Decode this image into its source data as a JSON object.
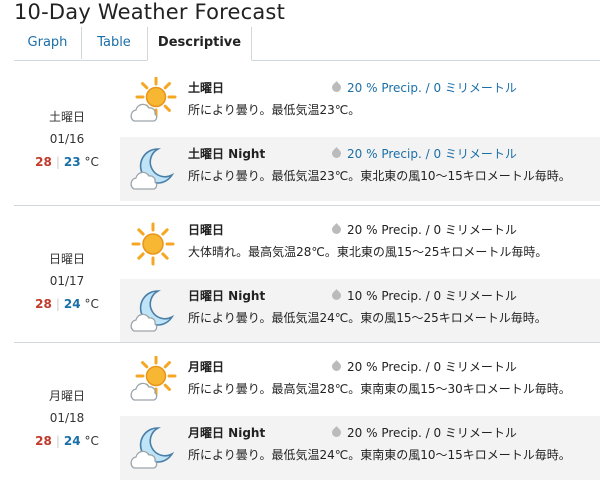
{
  "title": "10-Day Weather Forecast",
  "tabs": [
    "Graph",
    "Table",
    "Descriptive"
  ],
  "days": [
    {
      "name": "土曜日",
      "date": "01/16",
      "high": "28",
      "low": "23",
      "unit": "°C",
      "periods": [
        {
          "name": "土曜日",
          "icon": "sun-cloud-icon",
          "pct": "20",
          "pct_label": "% Precip. /",
          "amount": "0",
          "amount_unit": "ミリメートル",
          "highlight": true,
          "desc": "所により曇り。最低気温23℃。"
        },
        {
          "name": "土曜日 Night",
          "icon": "moon-cloud-icon",
          "pct": "20",
          "pct_label": "% Precip. /",
          "amount": "0",
          "amount_unit": "ミリメートル",
          "highlight": true,
          "desc": "所により曇り。最低気温23℃。東北東の風10～15キロメートル毎時。"
        }
      ]
    },
    {
      "name": "日曜日",
      "date": "01/17",
      "high": "28",
      "low": "24",
      "unit": "°C",
      "periods": [
        {
          "name": "日曜日",
          "icon": "sun-icon",
          "pct": "20",
          "pct_label": "% Precip. /",
          "amount": "0",
          "amount_unit": "ミリメートル",
          "highlight": false,
          "desc": "大体晴れ。最高気温28℃。東北東の風15～25キロメートル毎時。"
        },
        {
          "name": "日曜日 Night",
          "icon": "moon-cloud-icon",
          "pct": "10",
          "pct_label": "% Precip. /",
          "amount": "0",
          "amount_unit": "ミリメートル",
          "highlight": false,
          "desc": "所により曇り。最低気温24℃。東の風15～25キロメートル毎時。"
        }
      ]
    },
    {
      "name": "月曜日",
      "date": "01/18",
      "high": "28",
      "low": "24",
      "unit": "°C",
      "periods": [
        {
          "name": "月曜日",
          "icon": "sun-cloud-icon",
          "pct": "20",
          "pct_label": "% Precip. /",
          "amount": "0",
          "amount_unit": "ミリメートル",
          "highlight": false,
          "desc": "所により曇り。最高気温28℃。東南東の風15～30キロメートル毎時。"
        },
        {
          "name": "月曜日 Night",
          "icon": "moon-cloud-icon",
          "pct": "20",
          "pct_label": "% Precip. /",
          "amount": "0",
          "amount_unit": "ミリメートル",
          "highlight": false,
          "desc": "所により曇り。最低気温24℃。東南東の風10～15キロメートル毎時。"
        }
      ]
    }
  ],
  "colors": {
    "high": "#c0392b",
    "low": "#1b6fa8",
    "link": "#1b6fa8",
    "sun": "#f5a623"
  }
}
